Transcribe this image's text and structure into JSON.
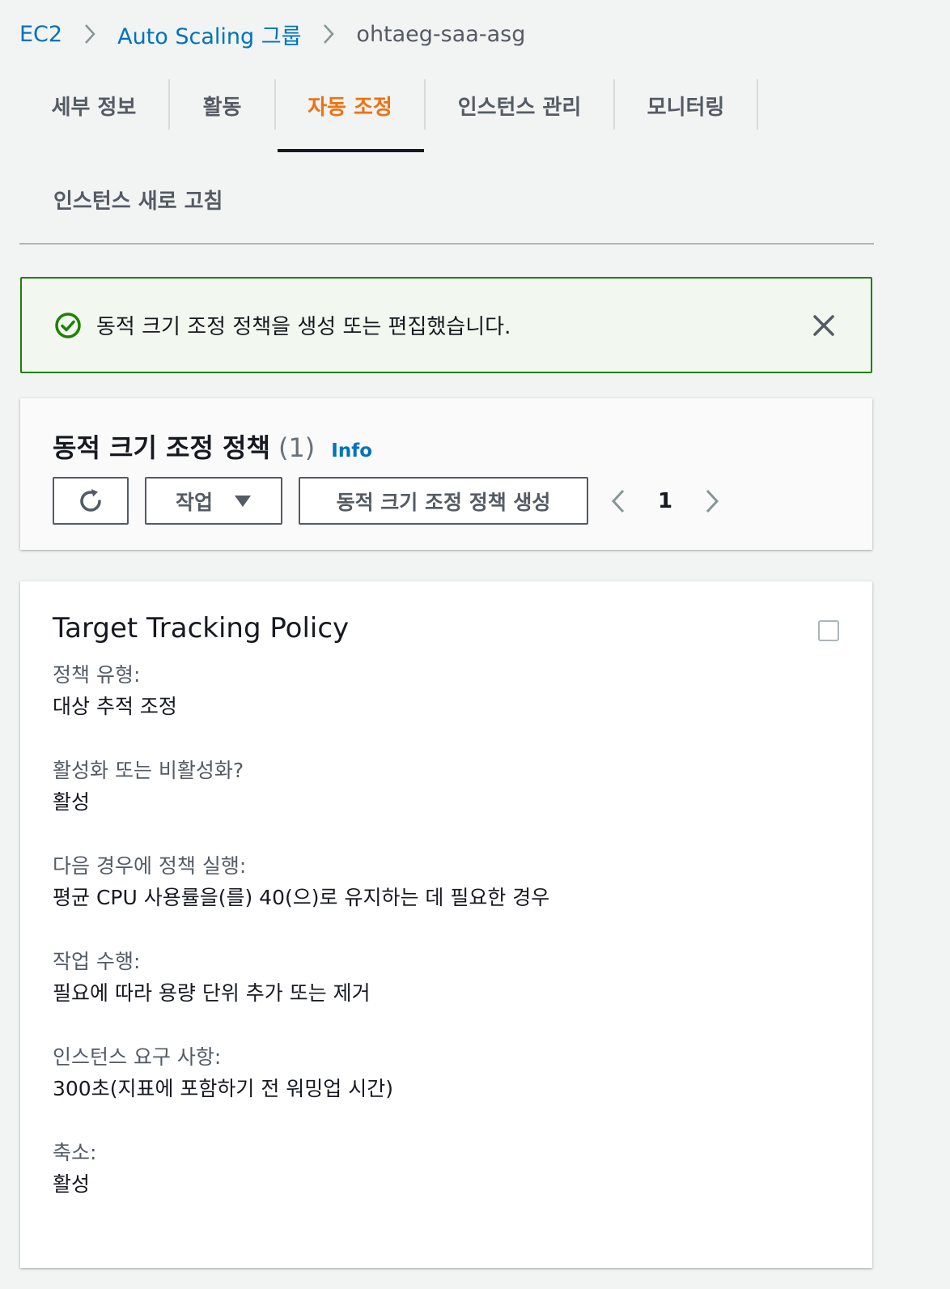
{
  "breadcrumb": {
    "items": [
      "EC2",
      "Auto Scaling 그룹"
    ],
    "current": "ohtaeg-saa-asg"
  },
  "tabs": {
    "row1": [
      "세부 정보",
      "활동",
      "자동 조정",
      "인스턴스 관리",
      "모니터링"
    ],
    "row2": [
      "인스턴스 새로 고침"
    ],
    "active": "자동 조정"
  },
  "flash": {
    "message": "동적 크기 조정 정책을 생성 또는 편집했습니다.",
    "icon": "success-check-icon"
  },
  "policies_panel": {
    "title": "동적 크기 조정 정책",
    "count": "(1)",
    "info": "Info",
    "actions_label": "작업",
    "create_label": "동적 크기 조정 정책 생성",
    "page": "1"
  },
  "policy_card": {
    "title": "Target Tracking Policy",
    "fields": [
      {
        "label": "정책 유형:",
        "value": "대상 추적 조정"
      },
      {
        "label": "활성화 또는 비활성화?",
        "value": "활성"
      },
      {
        "label": "다음 경우에 정책 실행:",
        "value": "평균 CPU 사용률을(를) 40(으)로 유지하는 데 필요한 경우"
      },
      {
        "label": "작업 수행:",
        "value": "필요에 따라 용량 단위 추가 또는 제거"
      },
      {
        "label": "인스턴스 요구 사항:",
        "value": "300초(지표에 포함하기 전 워밍업 시간)"
      },
      {
        "label": "축소:",
        "value": "활성"
      }
    ]
  },
  "colors": {
    "link": "#0073bb",
    "active_tab": "#ec7211",
    "success": "#1d8102",
    "text": "#16191f",
    "muted": "#545b64"
  }
}
